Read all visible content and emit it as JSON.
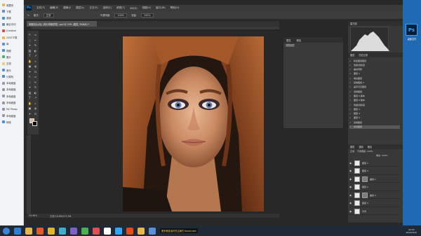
{
  "explorer": {
    "items": [
      {
        "label": "收藏夹",
        "color": "#e8b84a"
      },
      {
        "label": "下载",
        "color": "#5b8fd6"
      },
      {
        "label": "桌面",
        "color": "#4a8bd6"
      },
      {
        "label": "最近访问",
        "color": "#6b8fb6"
      },
      {
        "label": "Creative",
        "color": "#d65050"
      },
      {
        "label": "2345下载",
        "color": "#e8b84a"
      },
      {
        "label": "库",
        "color": "#5b8fd6"
      },
      {
        "label": "视频",
        "color": "#4a8bd6"
      },
      {
        "label": "图片",
        "color": "#4ab06a"
      },
      {
        "label": "文档",
        "color": "#e8d070"
      },
      {
        "label": "音乐",
        "color": "#5b8fd6"
      },
      {
        "label": "计算机",
        "color": "#4a8bd6"
      },
      {
        "label": "本地磁盘",
        "color": "#8a9bb0"
      },
      {
        "label": "本地磁盘",
        "color": "#8a9bb0"
      },
      {
        "label": "本地磁盘",
        "color": "#8a9bb0"
      },
      {
        "label": "本地磁盘",
        "color": "#8a9bb0"
      },
      {
        "label": "My Passp",
        "color": "#8a9bb0"
      },
      {
        "label": "本地磁盘",
        "color": "#8a9bb0"
      },
      {
        "label": "网络",
        "color": "#4a8bd6"
      }
    ]
  },
  "ps": {
    "logo": "Ps",
    "menu": [
      "文件(F)",
      "编辑(E)",
      "图像(I)",
      "图层(L)",
      "文字(Y)",
      "选择(S)",
      "滤镜(T)",
      "3D(D)",
      "视图(V)",
      "窗口(W)",
      "帮助(H)"
    ],
    "options": {
      "mode_label": "模式:",
      "mode_value": "正常",
      "opacity_label": "不透明度:",
      "opacity_value": "100%",
      "flow_label": "流量:",
      "flow_value": "100%"
    },
    "doc_tab": "修图前后对比 (照片明暗重塑) .psd @ 29% (图层, RGB/8) *",
    "status": {
      "zoom": "29.98%",
      "doc_size": "文档:16.8M/153.5M"
    }
  },
  "panels": {
    "mid_tabs": [
      "属性",
      "颜色"
    ],
    "mid_sub": "调整图层",
    "right_top_tabs": [
      "直方图"
    ],
    "history_tabs": [
      "图层",
      "历史记录"
    ],
    "history_items": [
      "新建图层图层",
      "色相/饱和度",
      "曲线调整",
      "图层 1",
      "填充图层",
      "复制图层 2",
      "盖印可见图层",
      "选择图层",
      "图层 6 副本",
      "图层 6 副本",
      "色相/饱和度",
      "图层 3",
      "图层 4",
      "图层 5",
      "复制图层",
      "合并图层"
    ],
    "history_selected": 15,
    "layers_tabs": [
      "图层",
      "通道",
      "路径"
    ],
    "layers_mode": "正常",
    "layers_opacity": "不透明度: 100%",
    "layers_fill": "填充: 100%",
    "layers": [
      {
        "name": "图层 1",
        "mask": false
      },
      {
        "name": "图层 4",
        "mask": false
      },
      {
        "name": "曲线 1",
        "mask": true
      },
      {
        "name": "图层 2",
        "mask": false
      },
      {
        "name": "曲线 2",
        "mask": true
      },
      {
        "name": "图层 3",
        "mask": false
      },
      {
        "name": "背景",
        "mask": false
      }
    ]
  },
  "desktop": {
    "icon": "Ps",
    "label": "桌面文件"
  },
  "taskbar": {
    "apps": [
      {
        "name": "start",
        "color": "#3a86d9"
      },
      {
        "name": "ie",
        "color": "#2f7fd4"
      },
      {
        "name": "explorer",
        "color": "#e6b84c"
      },
      {
        "name": "media",
        "color": "#e35a28"
      },
      {
        "name": "chrome",
        "color": "#dfb62b"
      },
      {
        "name": "app5",
        "color": "#3fb0c8"
      },
      {
        "name": "app6",
        "color": "#7f60c2"
      },
      {
        "name": "app7",
        "color": "#4caf50"
      },
      {
        "name": "app8",
        "color": "#e05050"
      },
      {
        "name": "app9",
        "color": "#ffffff"
      },
      {
        "name": "photoshop",
        "color": "#31a8ff"
      },
      {
        "name": "app11",
        "color": "#e64a19"
      },
      {
        "name": "app12",
        "color": "#e8b84a"
      },
      {
        "name": "app13",
        "color": "#5b8fd6"
      }
    ],
    "url_text": "更多美发素材关注我们 tianai.com",
    "time": "22:03",
    "date": "2016/3/22"
  }
}
